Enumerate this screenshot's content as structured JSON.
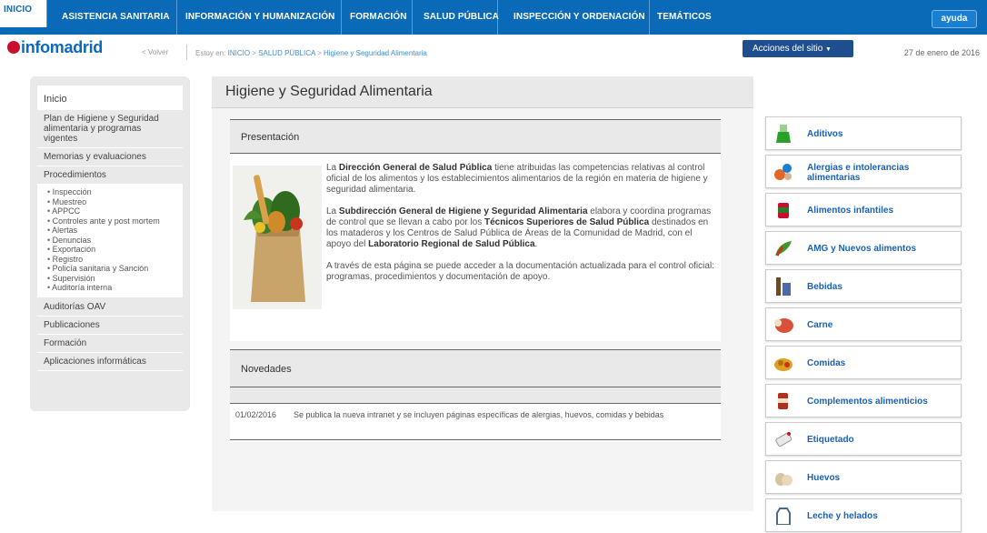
{
  "nav": {
    "tabs": [
      "INICIO",
      "ASISTENCIA SANITARIA",
      "INFORMACIÓN Y HUMANIZACIÓN",
      "FORMACIÓN",
      "SALUD PÚBLICA",
      "INSPECCIÓN Y ORDENACIÓN",
      "TEMÁTICOS"
    ],
    "help": "ayuda"
  },
  "header": {
    "logo": "infomadrid",
    "back": "< Volver",
    "crumb_prefix": "Estoy en:",
    "crumb_1": "INICIO",
    "crumb_2": "SALUD PÚBLICA",
    "crumb_3": "Higiene y Seguridad Alimentaria",
    "crumb_sep": ">",
    "actions": "Acciones del sitio",
    "date": "27 de enero de 2016"
  },
  "sidebar": {
    "items": [
      "Inicio",
      "Plan de Higiene y Seguridad alimentaria y programas vigentes",
      "Memorias y evaluaciones",
      "Procedimientos"
    ],
    "subitems": [
      "Inspección",
      "Muestreo",
      "APPCC",
      "Controles ante y post mortem",
      "Alertas",
      "Denuncias",
      "Exportación",
      "Registro",
      "Policía sanitaria y Sanción",
      "Supervisión",
      "Auditoría interna"
    ],
    "items_after": [
      "Auditorías OAV",
      "Publicaciones",
      "Formación",
      "Aplicaciones informáticas"
    ]
  },
  "main": {
    "title": "Higiene y Seguridad Alimentaria",
    "presentacion": "Presentación",
    "p1_a": "La ",
    "p1_b": "Dirección General de Salud Pública",
    "p1_c": " tiene atribuidas las competencias relativas al control oficial de los alimentos y los establecimientos alimentarios de la región en materia de higiene y seguridad alimentaria.",
    "p2_a": "La ",
    "p2_b": "Subdirección General de Higiene y Seguridad Alimentaria",
    "p2_c": " elabora y coordina programas de control que se llevan a cabo por los ",
    "p2_d": "Técnicos Superiores de Salud Pública",
    "p2_e": " destinados en los mataderos y los Centros de Salud Pública de Áreas de la Comunidad de Madrid, con el apoyo del ",
    "p2_f": "Laboratorio Regional de Salud Pública",
    "p2_g": ".",
    "p3": "A través de esta página se puede acceder a la documentación actualizada para el control oficial: programas, procedimientos y documentación de apoyo.",
    "novedades": "Novedades",
    "news_date": "01/02/2016",
    "news_text": "Se publica la nueva intranet y se incluyen páginas específicas de alergias, huevos, comidas y bebidas"
  },
  "right": {
    "buttons": [
      {
        "label": "Aditivos",
        "icon": "flask-icon",
        "color": "#2aa02a"
      },
      {
        "label": "Alergias e intolerancias alimentarias",
        "icon": "allergy-icon",
        "color": "#e0662a"
      },
      {
        "label": "Alimentos infantiles",
        "icon": "baby-food-icon",
        "color": "#c8102e"
      },
      {
        "label": "AMG y Nuevos alimentos",
        "icon": "leaf-icon",
        "color": "#3a9a2a"
      },
      {
        "label": "Bebidas",
        "icon": "bottle-icon",
        "color": "#6b4a2a"
      },
      {
        "label": "Carne",
        "icon": "meat-icon",
        "color": "#d8523a"
      },
      {
        "label": "Comidas",
        "icon": "food-icon",
        "color": "#e0a020"
      },
      {
        "label": "Complementos alimenticios",
        "icon": "supplement-icon",
        "color": "#b03020"
      },
      {
        "label": "Etiquetado",
        "icon": "label-icon",
        "color": "#c8102e"
      },
      {
        "label": "Huevos",
        "icon": "egg-icon",
        "color": "#d8c4a0"
      },
      {
        "label": "Leche y helados",
        "icon": "milk-icon",
        "color": "#4a6a8a"
      }
    ]
  }
}
